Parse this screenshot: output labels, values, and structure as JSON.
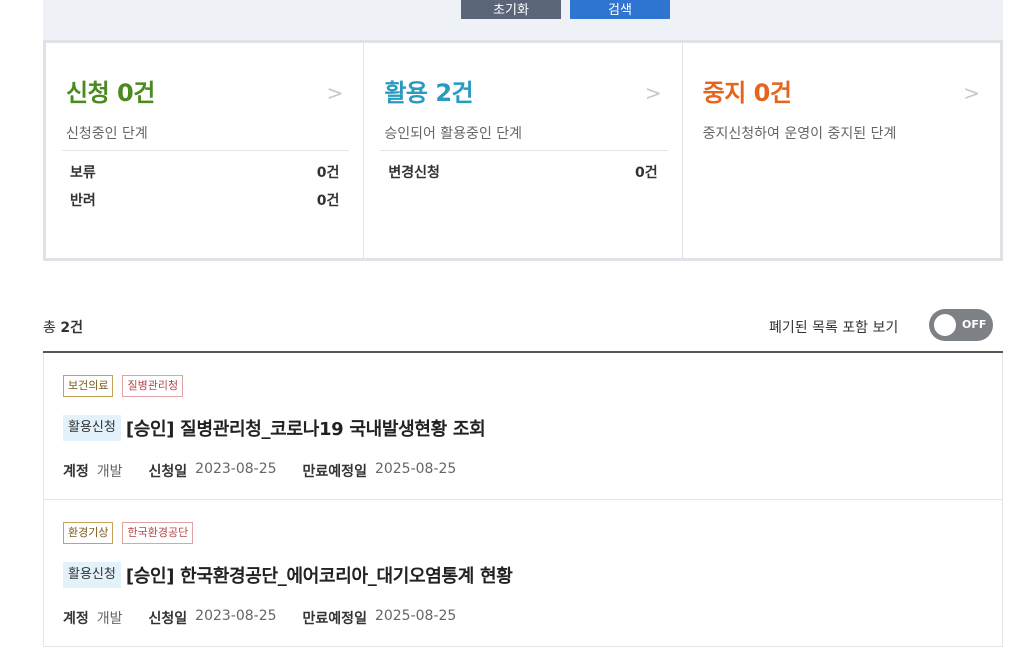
{
  "search": {
    "reset_label": "초기화",
    "search_label": "검색"
  },
  "summary": {
    "cards": [
      {
        "title": "신청 0건",
        "arrow": ">",
        "desc": "신청중인 단계",
        "color": "#4a8a1f",
        "rows": [
          {
            "label": "보류",
            "value": "0건"
          },
          {
            "label": "반려",
            "value": "0건"
          }
        ]
      },
      {
        "title": "활용 2건",
        "arrow": ">",
        "desc": "승인되어 활용중인 단계",
        "color": "#2a9bc0",
        "rows": [
          {
            "label": "변경신청",
            "value": "0건"
          }
        ]
      },
      {
        "title": "중지 0건",
        "arrow": ">",
        "desc": "중지신청하여 운영이 중지된 단계",
        "color": "#e5641e",
        "rows": []
      }
    ]
  },
  "list_header": {
    "total_prefix": "총 ",
    "total_count": "2건",
    "toggle_label": "폐기된 목록 포함 보기",
    "toggle_state": "OFF"
  },
  "items": [
    {
      "category": "보건의료",
      "org": "질병관리청",
      "status": "활용신청",
      "title": "[승인] 질병관리청_코로나19 국내발생현황 조회",
      "account_label": "계정",
      "account": "개발",
      "applied_label": "신청일",
      "applied": "2023-08-25",
      "expires_label": "만료예정일",
      "expires": "2025-08-25"
    },
    {
      "category": "환경기상",
      "org": "한국환경공단",
      "status": "활용신청",
      "title": "[승인] 한국환경공단_에어코리아_대기오염통계 현황",
      "account_label": "계정",
      "account": "개발",
      "applied_label": "신청일",
      "applied": "2023-08-25",
      "expires_label": "만료예정일",
      "expires": "2025-08-25"
    }
  ]
}
